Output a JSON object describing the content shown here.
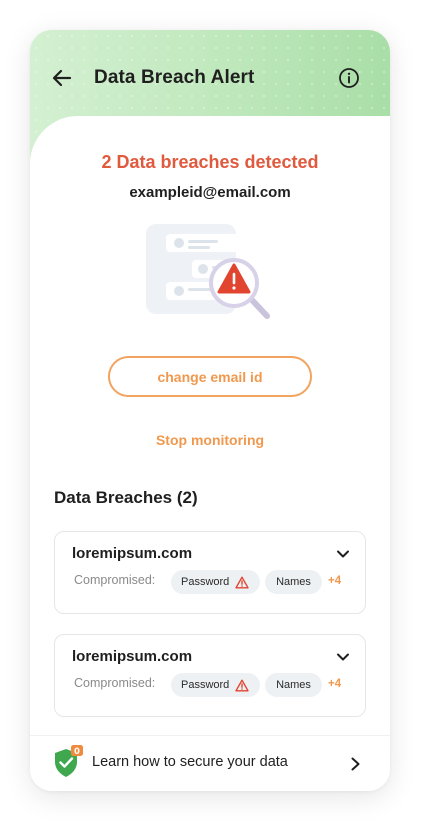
{
  "header": {
    "title": "Data Breach Alert",
    "back_icon": "arrow-left-icon",
    "info_icon": "info-icon"
  },
  "alert": {
    "heading": "2 Data breaches detected",
    "email": "exampleid@email.com",
    "illustration_icon": "breach-search-illustration"
  },
  "actions": {
    "change_email_label": "change email id",
    "stop_monitoring_label": "Stop monitoring"
  },
  "breaches": {
    "section_title": "Data Breaches (2)",
    "compromised_label": "Compromised:",
    "items": [
      {
        "domain": "loremipsum.com",
        "chips": [
          "Password",
          "Names"
        ],
        "more": "+4"
      },
      {
        "domain": "loremipsum.com",
        "chips": [
          "Password",
          "Names"
        ],
        "more": "+4"
      }
    ]
  },
  "banner": {
    "text": "Learn how to secure your data",
    "badge": "0",
    "icon": "shield-check-icon"
  },
  "colors": {
    "accent_orange": "#f0994e",
    "alert_red": "#e05a3e",
    "header_green": "#bfe8bc"
  }
}
